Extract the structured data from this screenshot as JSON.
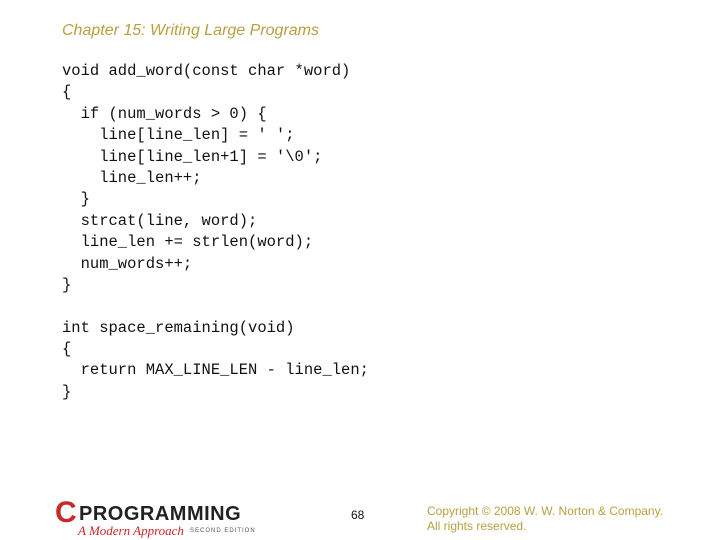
{
  "slide": {
    "title": "Chapter 15: Writing Large Programs",
    "code_lines": [
      "void add_word(const char *word)",
      "{",
      "  if (num_words > 0) {",
      "    line[line_len] = ' ';",
      "    line[line_len+1] = '\\0';",
      "    line_len++;",
      "  }",
      "  strcat(line, word);",
      "  line_len += strlen(word);",
      "  num_words++;",
      "}",
      "",
      "int space_remaining(void)",
      "{",
      "  return MAX_LINE_LEN - line_len;",
      "}"
    ],
    "page_number": "68",
    "copyright_line1": "Copyright © 2008 W. W. Norton & Company.",
    "copyright_line2": "All rights reserved."
  },
  "logo": {
    "letter": "C",
    "word": "PROGRAMMING",
    "subtitle": "A Modern Approach",
    "edition": "SECOND EDITION"
  },
  "colors": {
    "title": "#b8a040",
    "copyright": "#b8a040",
    "logo_red": "#c8282a",
    "code": "#111111"
  }
}
